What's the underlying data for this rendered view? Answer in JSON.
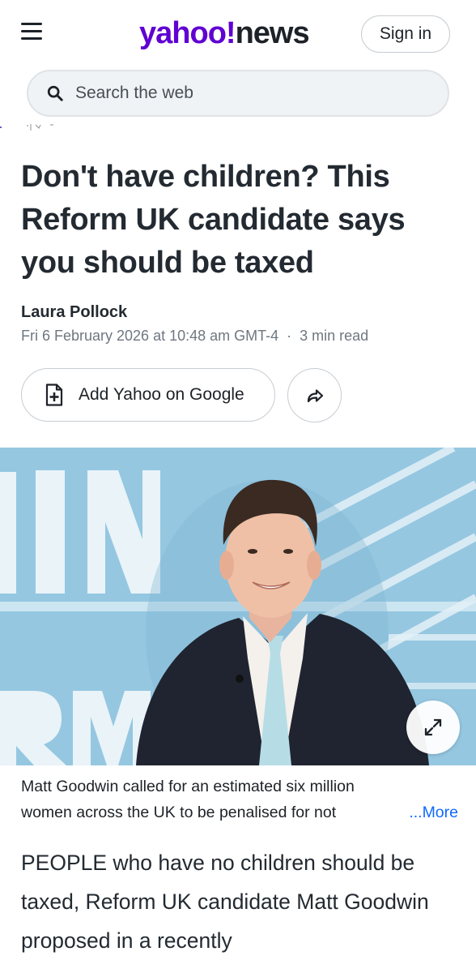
{
  "header": {
    "logo_yahoo": "yahoo!",
    "logo_news": "news",
    "signin_label": "Sign in"
  },
  "search": {
    "placeholder": "Search the web"
  },
  "article": {
    "title": "Don't have children? This Reform UK candidate says you should be taxed",
    "author": "Laura Pollock",
    "date": "Fri 6 February 2026 at 10:48 am GMT-4",
    "separator": "·",
    "read_time": "3 min read",
    "add_button_label": "Add Yahoo on Google",
    "caption_line1": "Matt Goodwin called for an estimated six million",
    "caption_line2": "women across the UK to be penalised for not",
    "caption_more": "...More",
    "body": "PEOPLE who have no children should be taxed, Reform UK candidate Matt Goodwin proposed in a recently"
  },
  "colors": {
    "brand_purple": "#6001d2",
    "link_blue": "#0f69ff",
    "hero_background": "#8ec3df"
  },
  "icons": {
    "menu": "hamburger-menu-icon",
    "search": "search-icon",
    "add": "add-document-icon",
    "share": "share-arrow-icon",
    "expand": "expand-icon"
  }
}
